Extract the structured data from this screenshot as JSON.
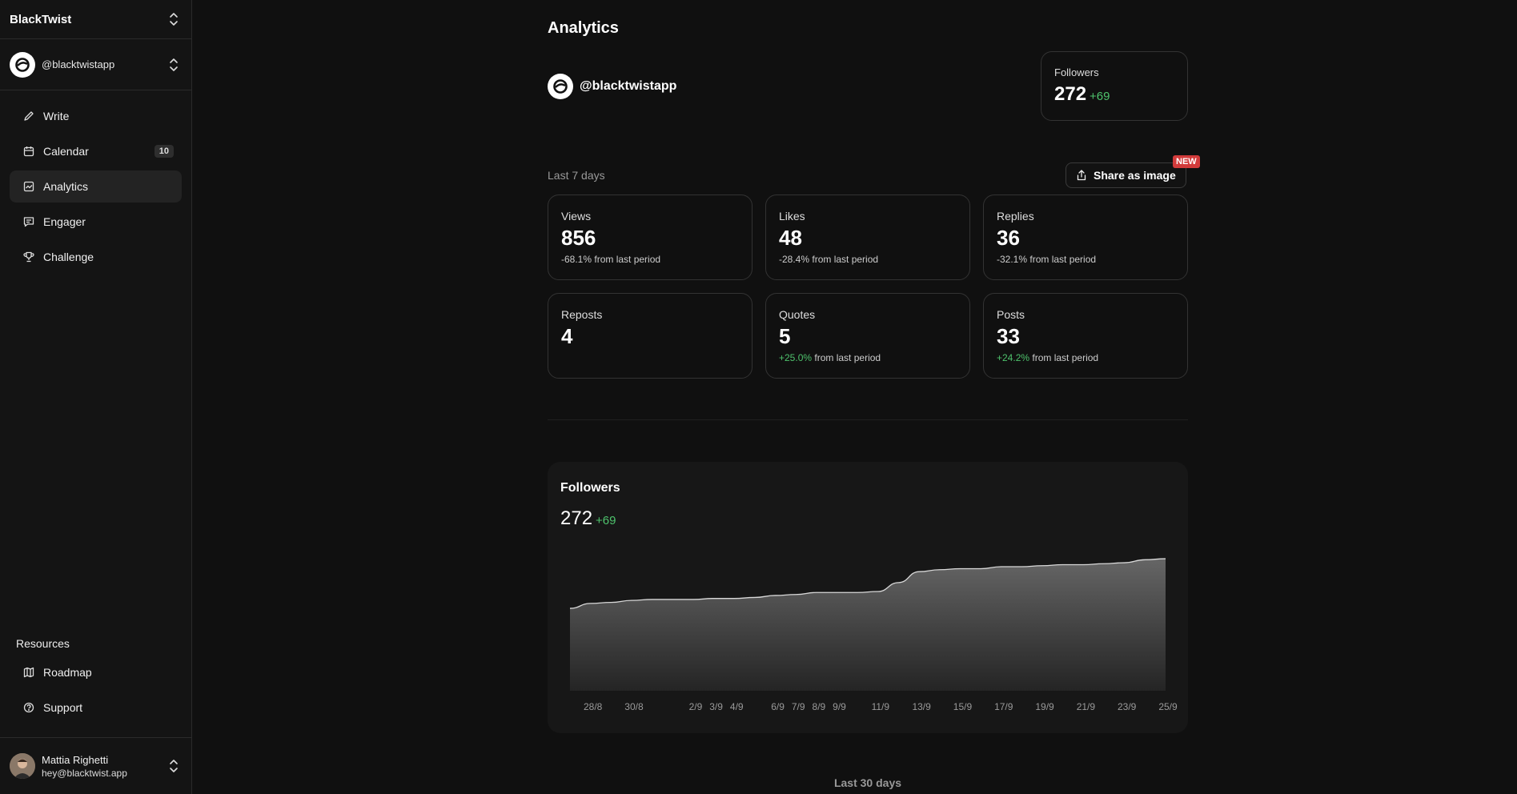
{
  "sidebar": {
    "brand": "BlackTwist",
    "account_handle": "@blacktwistapp",
    "nav": [
      {
        "label": "Write",
        "icon": "pencil-icon"
      },
      {
        "label": "Calendar",
        "icon": "calendar-icon",
        "badge": "10"
      },
      {
        "label": "Analytics",
        "icon": "chart-icon",
        "active": true
      },
      {
        "label": "Engager",
        "icon": "message-icon"
      },
      {
        "label": "Challenge",
        "icon": "trophy-icon"
      }
    ],
    "resources_title": "Resources",
    "resources": [
      {
        "label": "Roadmap",
        "icon": "map-icon"
      },
      {
        "label": "Support",
        "icon": "help-circle-icon"
      }
    ],
    "user": {
      "name": "Mattia Righetti",
      "email": "hey@blacktwist.app"
    }
  },
  "main": {
    "title": "Analytics",
    "profile_name": "@blacktwistapp",
    "followers_card": {
      "title": "Followers",
      "value": "272",
      "delta": "+69"
    },
    "period_label": "Last 7 days",
    "share_label": "Share as image",
    "new_badge": "NEW",
    "stats": [
      {
        "title": "Views",
        "value": "856",
        "change": "-68.1%",
        "suffix": " from last period",
        "positive": false
      },
      {
        "title": "Likes",
        "value": "48",
        "change": "-28.4%",
        "suffix": " from last period",
        "positive": false
      },
      {
        "title": "Replies",
        "value": "36",
        "change": "-32.1%",
        "suffix": " from last period",
        "positive": false
      },
      {
        "title": "Reposts",
        "value": "4",
        "change": "",
        "suffix": "",
        "positive": false
      },
      {
        "title": "Quotes",
        "value": "5",
        "change": "+25.0%",
        "suffix": " from last period",
        "positive": true
      },
      {
        "title": "Posts",
        "value": "33",
        "change": "+24.2%",
        "suffix": " from last period",
        "positive": true
      }
    ],
    "chart_title": "Followers",
    "chart_value": "272",
    "chart_delta": "+69",
    "last30_label": "Last 30 days"
  },
  "colors": {
    "accent_positive": "#4ec26c",
    "badge_new": "#d23b3b"
  },
  "chart_data": {
    "type": "area",
    "x": [
      "27/8",
      "28/8",
      "29/8",
      "30/8",
      "31/8",
      "1/9",
      "2/9",
      "3/9",
      "4/9",
      "5/9",
      "6/9",
      "7/9",
      "8/9",
      "9/9",
      "10/9",
      "11/9",
      "12/9",
      "13/9",
      "14/9",
      "15/9",
      "16/9",
      "17/9",
      "18/9",
      "19/9",
      "20/9",
      "21/9",
      "22/9",
      "23/9",
      "24/9",
      "25/9"
    ],
    "xticks": [
      "28/8",
      "30/8",
      "2/9",
      "3/9",
      "4/9",
      "6/9",
      "7/9",
      "8/9",
      "9/9",
      "11/9",
      "13/9",
      "15/9",
      "17/9",
      "19/9",
      "21/9",
      "23/9",
      "25/9"
    ],
    "series": [
      {
        "values": [
          203,
          208,
          209,
          211,
          212,
          212,
          212,
          213,
          213,
          214,
          216,
          217,
          219,
          219,
          219,
          220,
          229,
          240,
          242,
          243,
          243,
          245,
          245,
          246,
          247,
          247,
          248,
          249,
          252,
          253
        ]
      }
    ],
    "ylim": [
      120,
      270
    ],
    "grid": false,
    "legend": "none"
  }
}
